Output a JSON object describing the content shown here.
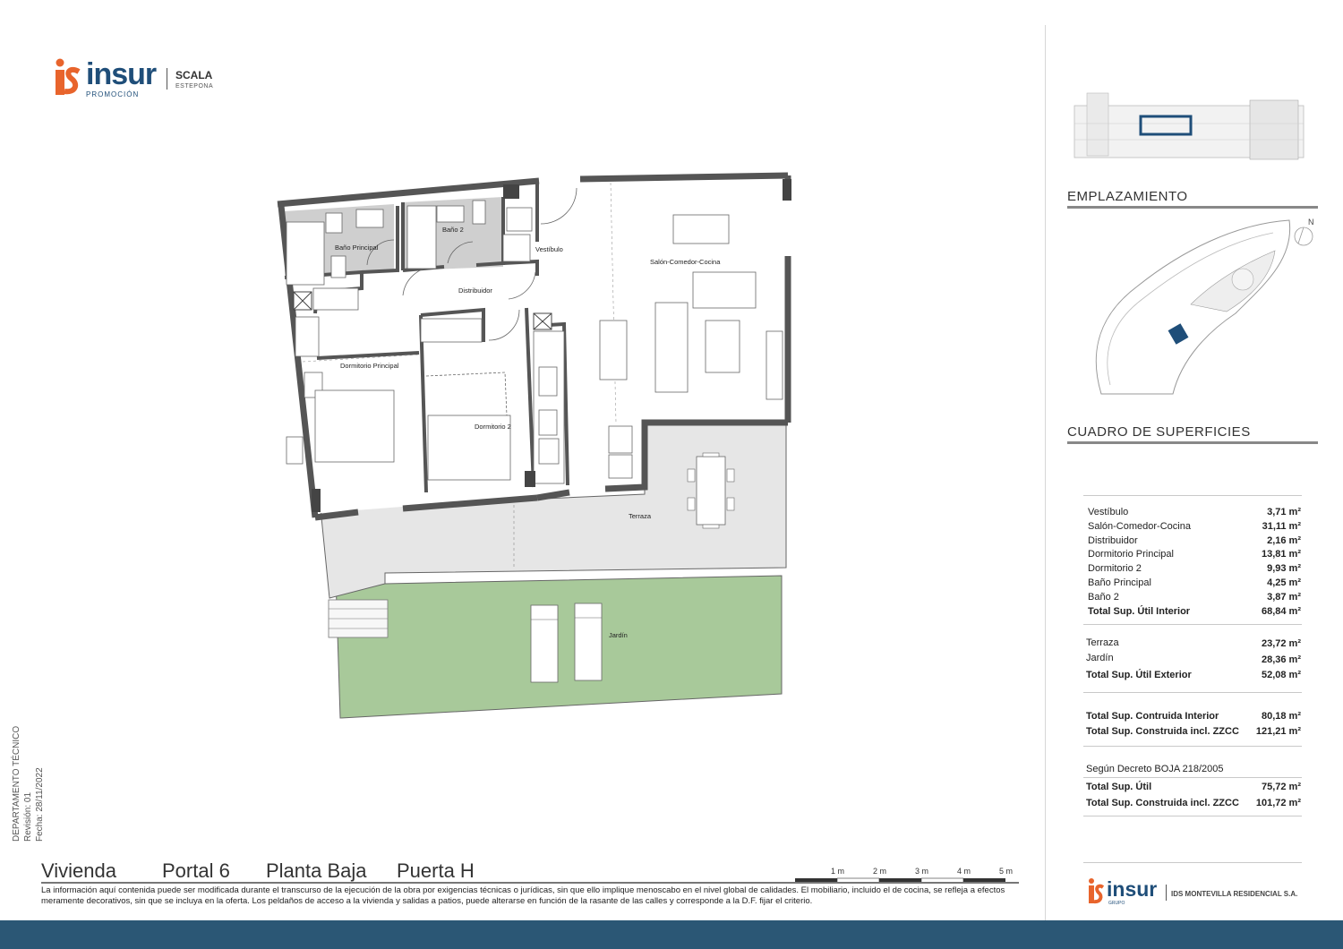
{
  "header": {
    "brand": "insur",
    "brand_sub": "PROMOCIÓN",
    "project": "SCALA",
    "project_sub": "ESTEPONA"
  },
  "rooms": {
    "bano_principal": "Baño Principal",
    "bano_2": "Baño 2",
    "vestibulo": "Vestíbulo",
    "salon": "Salón-Comedor-Cocina",
    "distribuidor": "Distribuidor",
    "dormitorio_principal": "Dormitorio Principal",
    "dormitorio_2": "Dormitorio 2",
    "terraza": "Terraza",
    "jardin": "Jardín"
  },
  "emplazamiento": {
    "title": "EMPLAZAMIENTO",
    "north": "N"
  },
  "superficies": {
    "title": "CUADRO DE SUPERFICIES",
    "interior": [
      {
        "label": "Vestíbulo",
        "value": "3,71 m²"
      },
      {
        "label": "Salón-Comedor-Cocina",
        "value": "31,11 m²"
      },
      {
        "label": "Distribuidor",
        "value": "2,16 m²"
      },
      {
        "label": "Dormitorio Principal",
        "value": "13,81 m²"
      },
      {
        "label": "Dormitorio 2",
        "value": "9,93 m²"
      },
      {
        "label": "Baño Principal",
        "value": "4,25 m²"
      },
      {
        "label": "Baño 2",
        "value": "3,87 m²"
      },
      {
        "label": "Total Sup. Útil Interior",
        "value": "68,84 m²"
      }
    ],
    "exterior": [
      {
        "label": "Terraza",
        "value": "23,72 m²"
      },
      {
        "label": "Jardín",
        "value": "28,36 m²"
      },
      {
        "label": "Total Sup. Útil Exterior",
        "value": "52,08 m²"
      }
    ],
    "construida": [
      {
        "label": "Total Sup. Contruida Interior",
        "value": "80,18 m²"
      },
      {
        "label": "Total Sup. Construida incl. ZZCC",
        "value": "121,21 m²"
      }
    ],
    "decreto_title": "Según Decreto BOJA 218/2005",
    "decreto": [
      {
        "label": "Total Sup. Útil",
        "value": "75,72 m²"
      },
      {
        "label": "Total Sup. Construida incl. ZZCC",
        "value": "101,72 m²"
      }
    ]
  },
  "side": {
    "line1": "DEPARTAMENTO TÉCNICO",
    "line2": "Revisión: 01",
    "line3": "Fecha: 28/11/2022"
  },
  "title": {
    "vivienda": "Vivienda",
    "portal": "Portal 6",
    "planta": "Planta Baja",
    "puerta": "Puerta H"
  },
  "scale": [
    "1 m",
    "2 m",
    "3 m",
    "4 m",
    "5 m"
  ],
  "disclaimer": "La información aquí contenida puede ser modificada durante el transcurso de la ejecución de la obra por exigencias técnicas o jurídicas, sin que ello implique menoscabo en el nivel global de calidades. El mobiliario, incluido el de cocina, se refleja a efectos meramente decorativos, sin que se incluya en la oferta. Los peldaños de acceso a la vivienda y salidas a patios, puede alterarse en función de la rasante de las calles y corresponde a  la D.F. fijar el criterio.",
  "footer_logo": {
    "brand": "insur",
    "brand_sub": "GRUPO",
    "company": "IDS MONTEVILLA RESIDENCIAL S.A."
  },
  "colors": {
    "brand_orange": "#e8642c",
    "brand_blue": "#1f4e79",
    "footer_bar": "#2b5775",
    "garden_green": "#a8c99a",
    "terrace_gray": "#e6e6e6",
    "wall": "#555555",
    "bath_floor": "#cfcfcf"
  }
}
